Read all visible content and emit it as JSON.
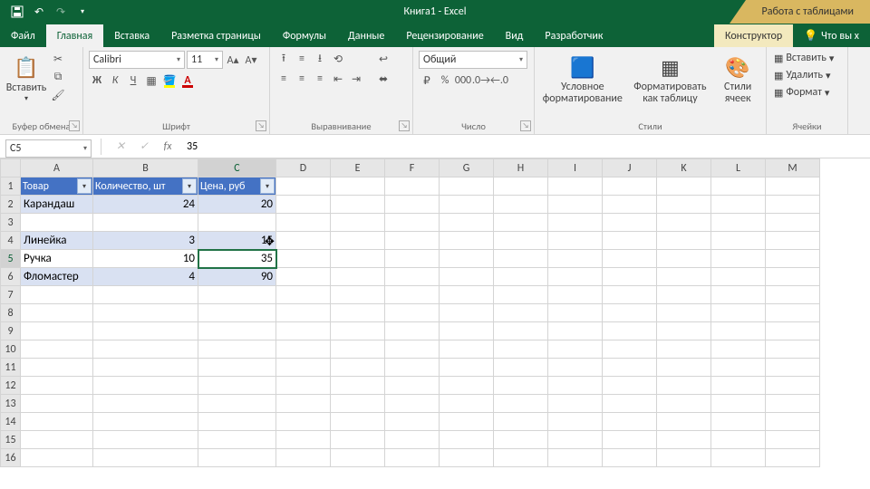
{
  "title": "Книга1  -  Excel",
  "context_title": "Работа с таблицами",
  "tabs": {
    "file": "Файл",
    "home": "Главная",
    "insert": "Вставка",
    "layout": "Разметка страницы",
    "formulas": "Формулы",
    "data": "Данные",
    "review": "Рецензирование",
    "view": "Вид",
    "developer": "Разработчик",
    "design": "Конструктор",
    "tell": "Что вы х"
  },
  "ribbon": {
    "clipboard": {
      "label": "Буфер обмена",
      "paste": "Вставить"
    },
    "font": {
      "label": "Шрифт",
      "name": "Calibri",
      "size": "11"
    },
    "align": {
      "label": "Выравнивание"
    },
    "number": {
      "label": "Число",
      "format": "Общий"
    },
    "styles": {
      "label": "Стили",
      "cond": "Условное форматирование",
      "table": "Форматировать как таблицу",
      "cell": "Стили ячеек"
    },
    "cells": {
      "label": "Ячейки",
      "insert": "Вставить",
      "delete": "Удалить",
      "format": "Формат"
    }
  },
  "namebox": "C5",
  "formula": "35",
  "columns": [
    "A",
    "B",
    "C",
    "D",
    "E",
    "F",
    "G",
    "H",
    "I",
    "J",
    "K",
    "L",
    "M"
  ],
  "headers": {
    "a": "Товар",
    "b": "Количество, шт",
    "c": "Цена, руб"
  },
  "rows": [
    {
      "a": "Карандаш",
      "b": "24",
      "c": "20"
    },
    {
      "a": "",
      "b": "",
      "c": ""
    },
    {
      "a": "Линейка",
      "b": "3",
      "c": "15"
    },
    {
      "a": "Ручка",
      "b": "10",
      "c": "35"
    },
    {
      "a": "Фломастер",
      "b": "4",
      "c": "90"
    }
  ],
  "chart_data": {
    "type": "table",
    "columns": [
      "Товар",
      "Количество, шт",
      "Цена, руб"
    ],
    "rows": [
      [
        "Карандаш",
        24,
        20
      ],
      [
        "Линейка",
        3,
        15
      ],
      [
        "Ручка",
        10,
        35
      ],
      [
        "Фломастер",
        4,
        90
      ]
    ]
  }
}
